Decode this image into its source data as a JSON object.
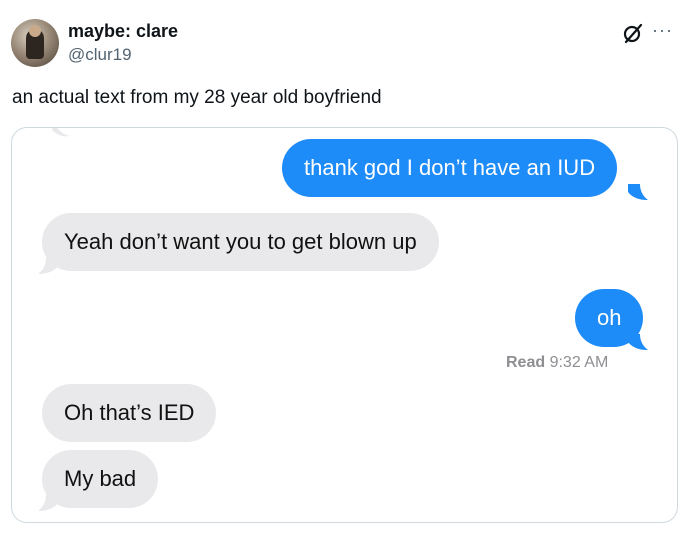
{
  "author": {
    "display_name": "maybe: clare",
    "handle": "@clur19"
  },
  "tweet": {
    "text": "an actual text from my 28 year old boyfriend"
  },
  "icons": {
    "grok": "grok-icon",
    "more": "more-options-icon"
  },
  "conversation": {
    "messages": [
      {
        "direction": "outgoing",
        "text": "thank god I don’t have an IUD"
      },
      {
        "direction": "incoming",
        "text": "Yeah don’t want you to get blown up"
      },
      {
        "direction": "outgoing",
        "text": "oh"
      },
      {
        "direction": "incoming",
        "text": "Oh that’s IED"
      },
      {
        "direction": "incoming",
        "text": "My bad"
      }
    ],
    "read_receipt": {
      "label": "Read",
      "time": "9:32 AM"
    }
  },
  "colors": {
    "outgoing_bubble": "#1d8bf8",
    "incoming_bubble": "#e9e9eb",
    "secondary_text": "#536471"
  }
}
